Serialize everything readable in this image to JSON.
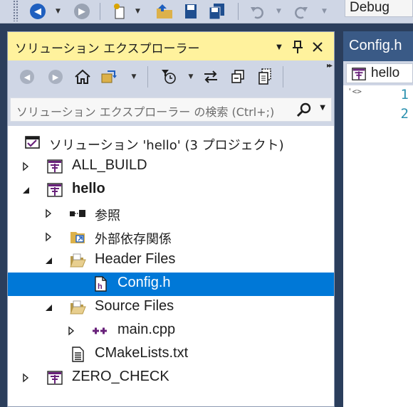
{
  "toolbar": {
    "configuration": "Debug"
  },
  "solution_explorer": {
    "title": "ソリューション エクスプローラー",
    "search_placeholder": "ソリューション エクスプローラー の検索 (Ctrl+;)",
    "tree": [
      {
        "label": "ソリューション 'hello' (3 プロジェクト)",
        "icon": "solution-icon",
        "expander": "none"
      },
      {
        "label": "ALL_BUILD",
        "icon": "project-icon",
        "expander": "collapsed"
      },
      {
        "label": "hello",
        "icon": "project-icon",
        "expander": "expanded",
        "bold": true
      },
      {
        "label": "参照",
        "icon": "references-icon",
        "expander": "collapsed"
      },
      {
        "label": "外部依存関係",
        "icon": "external-deps-icon",
        "expander": "collapsed"
      },
      {
        "label": "Header Files",
        "icon": "folder-open-icon",
        "expander": "expanded"
      },
      {
        "label": "Config.h",
        "icon": "header-file-icon",
        "expander": "none",
        "selected": true
      },
      {
        "label": "Source Files",
        "icon": "folder-open-icon",
        "expander": "expanded"
      },
      {
        "label": "main.cpp",
        "icon": "cpp-file-icon",
        "expander": "collapsed"
      },
      {
        "label": "CMakeLists.txt",
        "icon": "text-file-icon",
        "expander": "none"
      },
      {
        "label": "ZERO_CHECK",
        "icon": "project-icon",
        "expander": "collapsed"
      }
    ]
  },
  "editor": {
    "tab_title": "Config.h",
    "project_combo": "hello",
    "line_numbers": [
      "1",
      "2"
    ]
  },
  "colors": {
    "selection": "#0078d7",
    "title_active": "#fff29d",
    "toolbar_bg": "#cfd6e5",
    "frame_bg": "#2b3e5c",
    "project_purple": "#68217a"
  }
}
